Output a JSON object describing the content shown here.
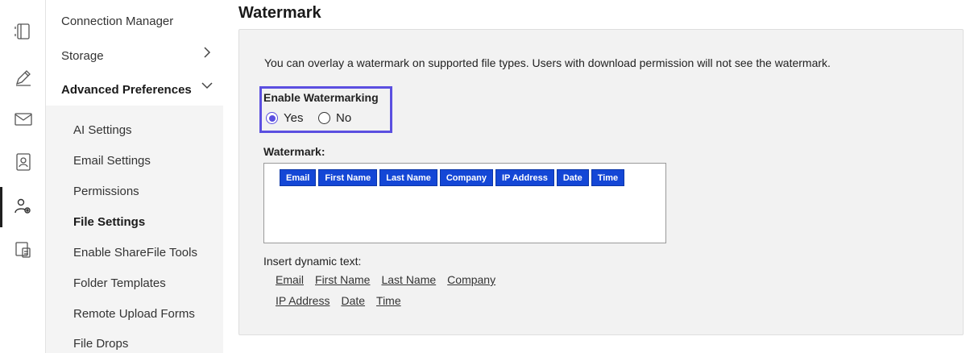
{
  "rail": {
    "items": [
      {
        "icon": "panel-toggle-icon"
      },
      {
        "icon": "pen-icon"
      },
      {
        "icon": "mail-icon"
      },
      {
        "icon": "contacts-icon"
      },
      {
        "icon": "user-settings-icon"
      },
      {
        "icon": "tablet-icon"
      }
    ]
  },
  "nav": {
    "top_items": [
      {
        "label": "Connection Manager"
      },
      {
        "label": "Storage"
      },
      {
        "label": "Advanced Preferences"
      }
    ],
    "sub_items": [
      {
        "label": "AI Settings"
      },
      {
        "label": "Email Settings"
      },
      {
        "label": "Permissions"
      },
      {
        "label": "File Settings"
      },
      {
        "label": "Enable ShareFile Tools"
      },
      {
        "label": "Folder Templates"
      },
      {
        "label": "Remote Upload Forms"
      },
      {
        "label": "File Drops"
      }
    ]
  },
  "main": {
    "title": "Watermark",
    "description": "You can overlay a watermark on supported file types. Users with download permission will not see the watermark.",
    "enable_label": "Enable Watermarking",
    "yes_label": "Yes",
    "no_label": "No",
    "watermark_label": "Watermark:",
    "chips": [
      "Email",
      "First Name",
      "Last Name",
      "Company",
      "IP Address",
      "Date",
      "Time"
    ],
    "insert_label": "Insert dynamic text:",
    "links_row1": [
      "Email",
      "First Name",
      "Last Name",
      "Company"
    ],
    "links_row2": [
      "IP Address",
      "Date",
      "Time"
    ]
  },
  "colors": {
    "accent": "#5b4fe0",
    "chip": "#1447d6"
  }
}
